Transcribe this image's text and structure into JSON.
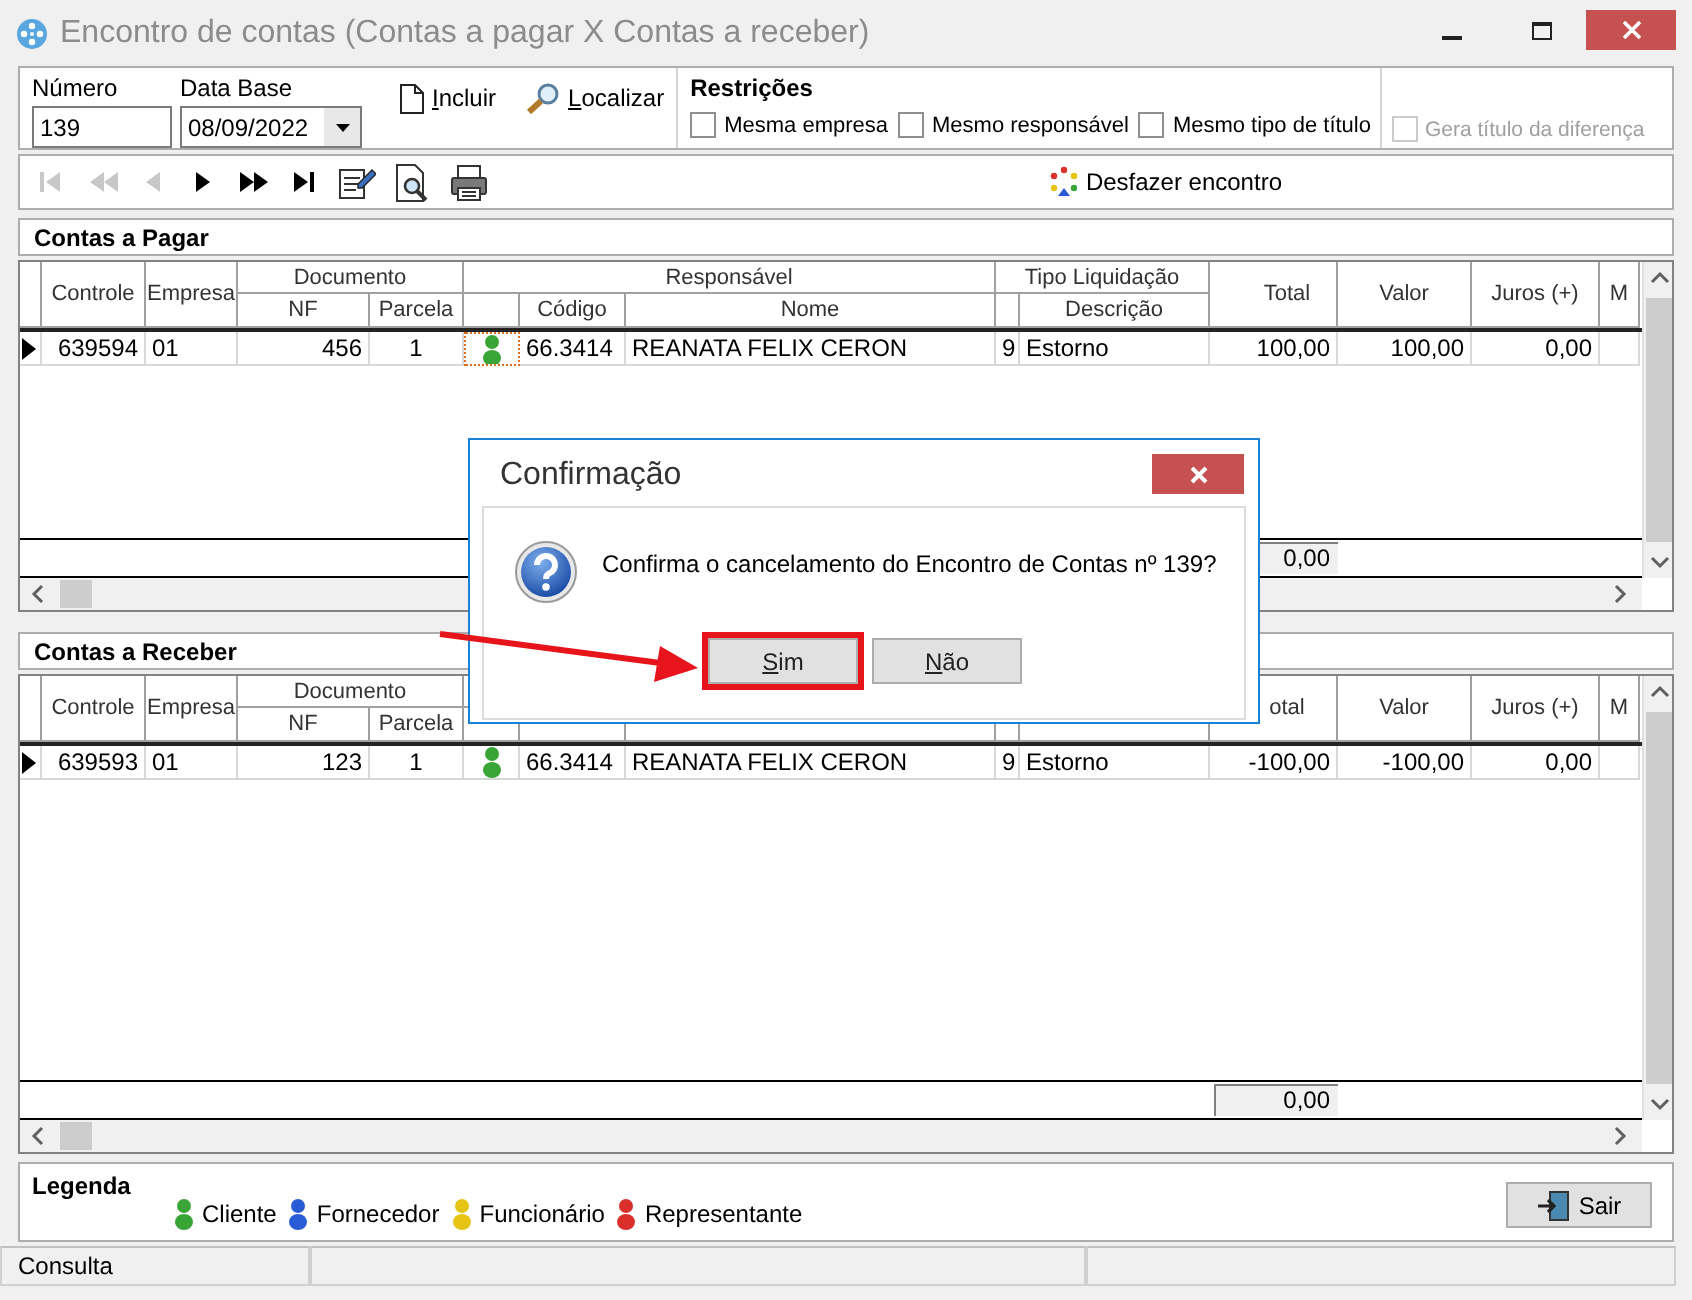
{
  "window": {
    "title": "Encontro de contas (Contas a pagar X Contas a receber)"
  },
  "fields": [
    {
      "label": "Número",
      "value": "139",
      "kind": "text"
    },
    {
      "label": "Data Base",
      "value": "08/09/2022",
      "kind": "date"
    }
  ],
  "actions": [
    {
      "label": "Incluir",
      "kind": "new"
    },
    {
      "label": "Localizar",
      "kind": "find"
    }
  ],
  "restricoes": {
    "title": "Restrições",
    "options": [
      {
        "label": "Mesma empresa",
        "checked": false
      },
      {
        "label": "Mesmo responsável",
        "checked": false
      },
      {
        "label": "Mesmo tipo de título",
        "checked": false
      }
    ]
  },
  "gera_titulo": {
    "label": "Gera título da diferença",
    "checked": false,
    "disabled": true
  },
  "navigator": [
    {
      "kind": "first",
      "disabled": true
    },
    {
      "kind": "prior_page",
      "disabled": true
    },
    {
      "kind": "prior",
      "disabled": true
    },
    {
      "kind": "next",
      "disabled": false
    },
    {
      "kind": "next_page",
      "disabled": false
    },
    {
      "kind": "last",
      "disabled": false
    }
  ],
  "tools": [
    {
      "kind": "edit"
    },
    {
      "kind": "preview"
    },
    {
      "kind": "print"
    }
  ],
  "undo_button": {
    "label": "Desfazer encontro"
  },
  "contas_a_pagar": {
    "title": "Contas a Pagar",
    "header": [
      {
        "label": "Controle"
      },
      {
        "label": "Empresa"
      },
      {
        "label": "Documento",
        "sub": [
          "NF",
          "Parcela"
        ]
      },
      {
        "label": "Responsável",
        "sub": [
          "Código",
          "Nome"
        ]
      },
      {
        "label": "Tipo Liquidação",
        "sub": [
          "Descrição"
        ]
      }
    ],
    "value_columns": [
      "Total",
      "Valor",
      "Juros (+)",
      "M"
    ],
    "rows": [
      {
        "selected": true,
        "focused": true,
        "color": "#3aa537",
        "cells": [
          "639594",
          "01",
          "456",
          "1",
          "66.3414",
          "REANATA FELIX CERON",
          "9",
          "Estorno",
          "100,00",
          "100,00",
          "0,00"
        ]
      }
    ],
    "total": "0,00"
  },
  "contas_a_receber": {
    "title": "Contas a Receber",
    "header": [
      {
        "label": "Controle"
      },
      {
        "label": "Empresa"
      },
      {
        "label": "Documento",
        "sub": [
          "NF",
          "Parcela"
        ]
      }
    ],
    "value_columns": [
      "otal",
      "Valor",
      "Juros (+)",
      "M"
    ],
    "rows": [
      {
        "selected": true,
        "focused": false,
        "color": "#3aa537",
        "cells": [
          "639593",
          "01",
          "123",
          "1",
          "66.3414",
          "REANATA FELIX CERON",
          "9",
          "Estorno",
          "-100,00",
          "-100,00",
          "0,00"
        ]
      }
    ],
    "total": "0,00"
  },
  "legend": {
    "title": "Legenda",
    "items": [
      {
        "label": "Cliente",
        "color": "#3aa537"
      },
      {
        "label": "Fornecedor",
        "color": "#2a5bd7"
      },
      {
        "label": "Funcionário",
        "color": "#e6c414"
      },
      {
        "label": "Representante",
        "color": "#d9302c"
      }
    ]
  },
  "exit_button": {
    "label": "Sair"
  },
  "status_bar": [
    "Consulta"
  ],
  "dialog": {
    "title": "Confirmação",
    "message": "Confirma o cancelamento do Encontro de Contas nº 139?",
    "buttons": [
      {
        "label": "Sim",
        "highlighted": true
      },
      {
        "label": "Não",
        "highlighted": false
      }
    ]
  }
}
